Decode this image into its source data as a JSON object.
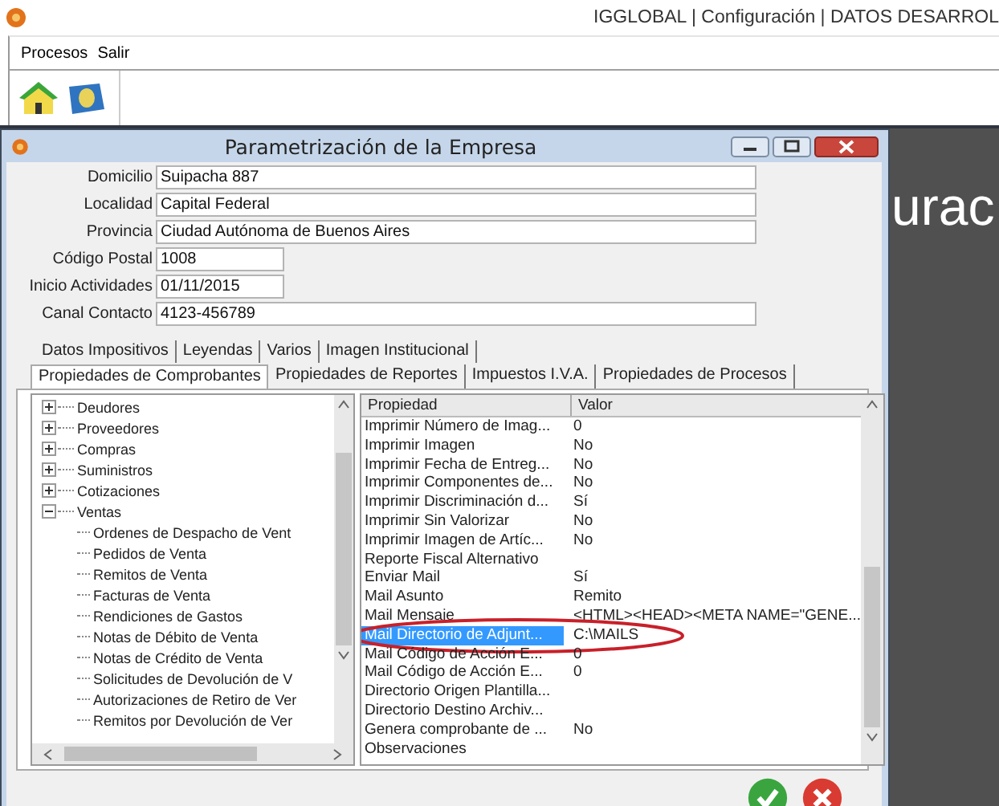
{
  "app": {
    "title": "IGGLOBAL | Configuración | DATOS DESARROL",
    "menu": [
      {
        "label": "Procesos"
      },
      {
        "label": "Salir"
      }
    ],
    "background_text": "urac"
  },
  "dialog": {
    "title": "Parametrización de la Empresa",
    "fields": [
      {
        "label": "Domicilio",
        "value": "Suipacha 887",
        "kind": "wide"
      },
      {
        "label": "Localidad",
        "value": "Capital Federal",
        "kind": "wide"
      },
      {
        "label": "Provincia",
        "value": "Ciudad Autónoma de Buenos Aires",
        "kind": "wide"
      },
      {
        "label": "Código Postal",
        "value": "1008",
        "kind": "narrow"
      },
      {
        "label": "Inicio Actividades",
        "value": "01/11/2015",
        "kind": "narrow"
      },
      {
        "label": "Canal Contacto",
        "value": "4123-456789",
        "kind": "wide"
      }
    ],
    "tabs_row1": [
      {
        "label": "Datos Impositivos",
        "selected": false
      },
      {
        "label": "Leyendas",
        "selected": false
      },
      {
        "label": "Varios",
        "selected": false
      },
      {
        "label": "Imagen Institucional",
        "selected": false
      }
    ],
    "tabs_row2": [
      {
        "label": "Propiedades de Comprobantes",
        "selected": true
      },
      {
        "label": "Propiedades de Reportes",
        "selected": false
      },
      {
        "label": "Impuestos I.V.A.",
        "selected": false
      },
      {
        "label": "Propiedades de Procesos",
        "selected": false
      }
    ],
    "tree": [
      {
        "label": "Deudores",
        "expanded": false
      },
      {
        "label": "Proveedores",
        "expanded": false
      },
      {
        "label": "Compras",
        "expanded": false
      },
      {
        "label": "Suministros",
        "expanded": false
      },
      {
        "label": "Cotizaciones",
        "expanded": false
      },
      {
        "label": "Ventas",
        "expanded": true,
        "children": [
          {
            "label": "Ordenes de Despacho de Vent"
          },
          {
            "label": "Pedidos de Venta"
          },
          {
            "label": "Remitos de Venta"
          },
          {
            "label": "Facturas de Venta"
          },
          {
            "label": "Rendiciones de Gastos"
          },
          {
            "label": "Notas de Débito de Venta"
          },
          {
            "label": "Notas de Crédito de Venta"
          },
          {
            "label": "Solicitudes de Devolución de V"
          },
          {
            "label": "Autorizaciones de Retiro de Ver"
          },
          {
            "label": "Remitos por Devolución de Ver"
          }
        ]
      }
    ],
    "grid": {
      "columns": [
        "Propiedad",
        "Valor"
      ],
      "rows": [
        {
          "name": "Imprimir Número de Imag...",
          "value": "0",
          "selected": false
        },
        {
          "name": "Imprimir Imagen",
          "value": "No",
          "selected": false
        },
        {
          "name": "Imprimir Fecha de Entreg...",
          "value": "No",
          "selected": false
        },
        {
          "name": "Imprimir Componentes de...",
          "value": "No",
          "selected": false
        },
        {
          "name": "Imprimir Discriminación d...",
          "value": "Sí",
          "selected": false
        },
        {
          "name": "Imprimir Sin Valorizar",
          "value": "No",
          "selected": false
        },
        {
          "name": "Imprimir Imagen de Artíc...",
          "value": "No",
          "selected": false
        },
        {
          "name": "Reporte Fiscal Alternativo",
          "selected": false
        },
        {
          "name": "Enviar Mail",
          "value": "Sí",
          "selected": false
        },
        {
          "name": "Mail Asunto",
          "value": "Remito",
          "selected": false
        },
        {
          "name": "Mail Mensaje",
          "value": "<HTML><HEAD><META NAME=\"GENE...",
          "selected": false
        },
        {
          "name": "Mail Directorio de Adjunt...",
          "value": "C:\\MAILS",
          "selected": true,
          "highlighted": true
        },
        {
          "name": "Mail Código de Acción E...",
          "value": "0",
          "selected": false
        },
        {
          "name": "Mail Código de Acción E...",
          "value": "0",
          "selected": false
        },
        {
          "name": "Directorio Origen Plantilla...",
          "selected": false
        },
        {
          "name": "Directorio Destino Archiv...",
          "selected": false
        },
        {
          "name": "Genera comprobante de ...",
          "value": "No",
          "selected": false
        },
        {
          "name": "Observaciones",
          "selected": false
        }
      ]
    }
  }
}
